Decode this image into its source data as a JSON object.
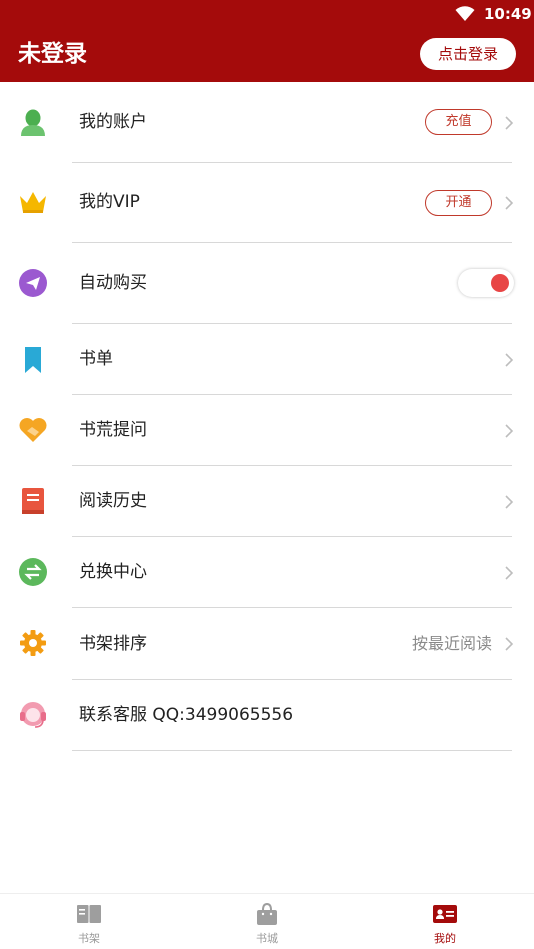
{
  "status_bar": {
    "time": "10:49"
  },
  "header": {
    "title": "未登录",
    "login_button": "点击登录"
  },
  "menu": {
    "account": {
      "label": "我的账户",
      "action": "充值"
    },
    "vip": {
      "label": "我的VIP",
      "action": "开通"
    },
    "auto_buy": {
      "label": "自动购买"
    },
    "booklist": {
      "label": "书单"
    },
    "book_request": {
      "label": "书荒提问"
    },
    "history": {
      "label": "阅读历史"
    },
    "exchange": {
      "label": "兑换中心"
    },
    "sort": {
      "label": "书架排序",
      "value": "按最近阅读"
    },
    "service": {
      "label": "联系客服 QQ:3499065556"
    }
  },
  "tabs": [
    {
      "label": "书架"
    },
    {
      "label": "书城"
    },
    {
      "label": "我的"
    }
  ],
  "colors": {
    "brand": "#a40b0b",
    "toggle_on": "#e84545",
    "divider": "#d8d8d8"
  }
}
